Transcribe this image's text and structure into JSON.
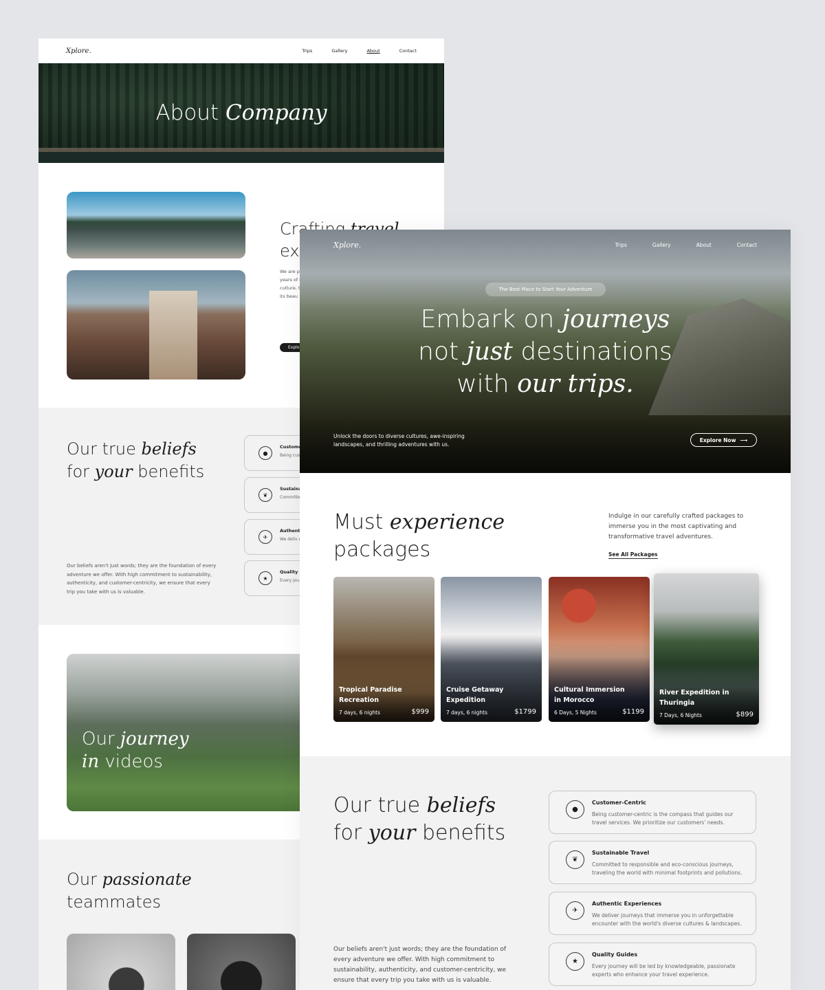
{
  "back_page": {
    "logo": "Xplore.",
    "nav": [
      "Trips",
      "Gallery",
      "About",
      "Contact"
    ],
    "hero_title_plain": "About",
    "hero_title_italic": "Company",
    "craft": {
      "title_plain": "Crafting",
      "title_italic": "travel",
      "title_line2": "exp",
      "paragraph": "We are p travel ex years of curating culture, traveler its beau",
      "button": "Explo"
    },
    "beliefs": {
      "line1_plain": "Our true",
      "line1_italic": "beliefs",
      "line2_plain1": "for",
      "line2_italic": "your",
      "line2_plain2": "benefits",
      "paragraph": "Our beliefs aren't just words; they are the foundation of every adventure we offer. With high commitment to sustainability, authenticity, and customer-centricity, we ensure that every trip you take with us is valuable.",
      "cards": [
        {
          "icon": "user-icon",
          "glyph": "●",
          "title": "Custome",
          "desc": "Being cus travel ser"
        },
        {
          "icon": "leaf-icon",
          "glyph": "❦",
          "title": "Sustainab",
          "desc": "Committe traveling t"
        },
        {
          "icon": "plane-icon",
          "glyph": "✈",
          "title": "Authenti",
          "desc": "We deliv encounte"
        },
        {
          "icon": "star-icon",
          "glyph": "★",
          "title": "Quality G",
          "desc": "Every jou experts w"
        }
      ]
    },
    "video": {
      "line1_plain": "Our",
      "line1_italic": "journey",
      "line2_italic": "in",
      "line2_plain": "videos"
    },
    "team": {
      "line1_plain": "Our",
      "line1_italic": "passionate",
      "line2": "teammates"
    }
  },
  "front_page": {
    "logo": "Xplore.",
    "nav": [
      "Trips",
      "Gallery",
      "About",
      "Contact"
    ],
    "pill": "The Best Place to Start Your Adventure",
    "hero": {
      "l1_plain": "Embark on",
      "l1_italic": "journeys",
      "l2_plain1": "not",
      "l2_italic": "just",
      "l2_plain2": "destinations",
      "l3_plain": "with",
      "l3_italic": "our trips."
    },
    "hero_sub": "Unlock the doors to diverse cultures, awe-inspiring landscapes, and thrilling adventures with us.",
    "cta": "Explore Now",
    "packages": {
      "title_plain1": "Must",
      "title_italic": "experience",
      "title_line2": "packages",
      "intro": "Indulge in our carefully crafted packages to immerse you in the most captivating and transformative travel adventures.",
      "see_all": "See All Packages",
      "items": [
        {
          "name": "Tropical Paradise Recreation",
          "duration": "7 days, 6 nights",
          "price": "$999"
        },
        {
          "name": "Cruise Getaway Expedition",
          "duration": "7 days, 6 nights",
          "price": "$1799"
        },
        {
          "name": "Cultural Immersion in Morocco",
          "duration": "6 Days, 5 Nights",
          "price": "$1199"
        },
        {
          "name": "River Expedition in Thuringia",
          "duration": "7 Days, 6 Nights",
          "price": "$899"
        }
      ]
    },
    "beliefs": {
      "line1_plain": "Our true",
      "line1_italic": "beliefs",
      "line2_plain1": "for",
      "line2_italic": "your",
      "line2_plain2": "benefits",
      "paragraph": "Our beliefs aren't just words; they are the foundation of every adventure we offer. With high commitment to sustainability, authenticity, and customer-centricity, we ensure that every trip you take with us is valuable.",
      "cards": [
        {
          "icon": "user-icon",
          "glyph": "●",
          "title": "Customer-Centric",
          "desc": "Being customer-centric is the compass that guides our travel services. We prioritize our customers' needs."
        },
        {
          "icon": "leaf-icon",
          "glyph": "❦",
          "title": "Sustainable Travel",
          "desc": "Committed to responsible and eco-conscious journeys, traveling the world with minimal footprints and pollutions."
        },
        {
          "icon": "plane-icon",
          "glyph": "✈",
          "title": "Authentic Experiences",
          "desc": "We deliver journeys that immerse you in unforgettable encounter with the world's diverse cultures & landscapes."
        },
        {
          "icon": "star-icon",
          "glyph": "★",
          "title": "Quality Guides",
          "desc": "Every journey will be led by knowledgeable, passionate experts who enhance your travel experience."
        }
      ]
    }
  }
}
